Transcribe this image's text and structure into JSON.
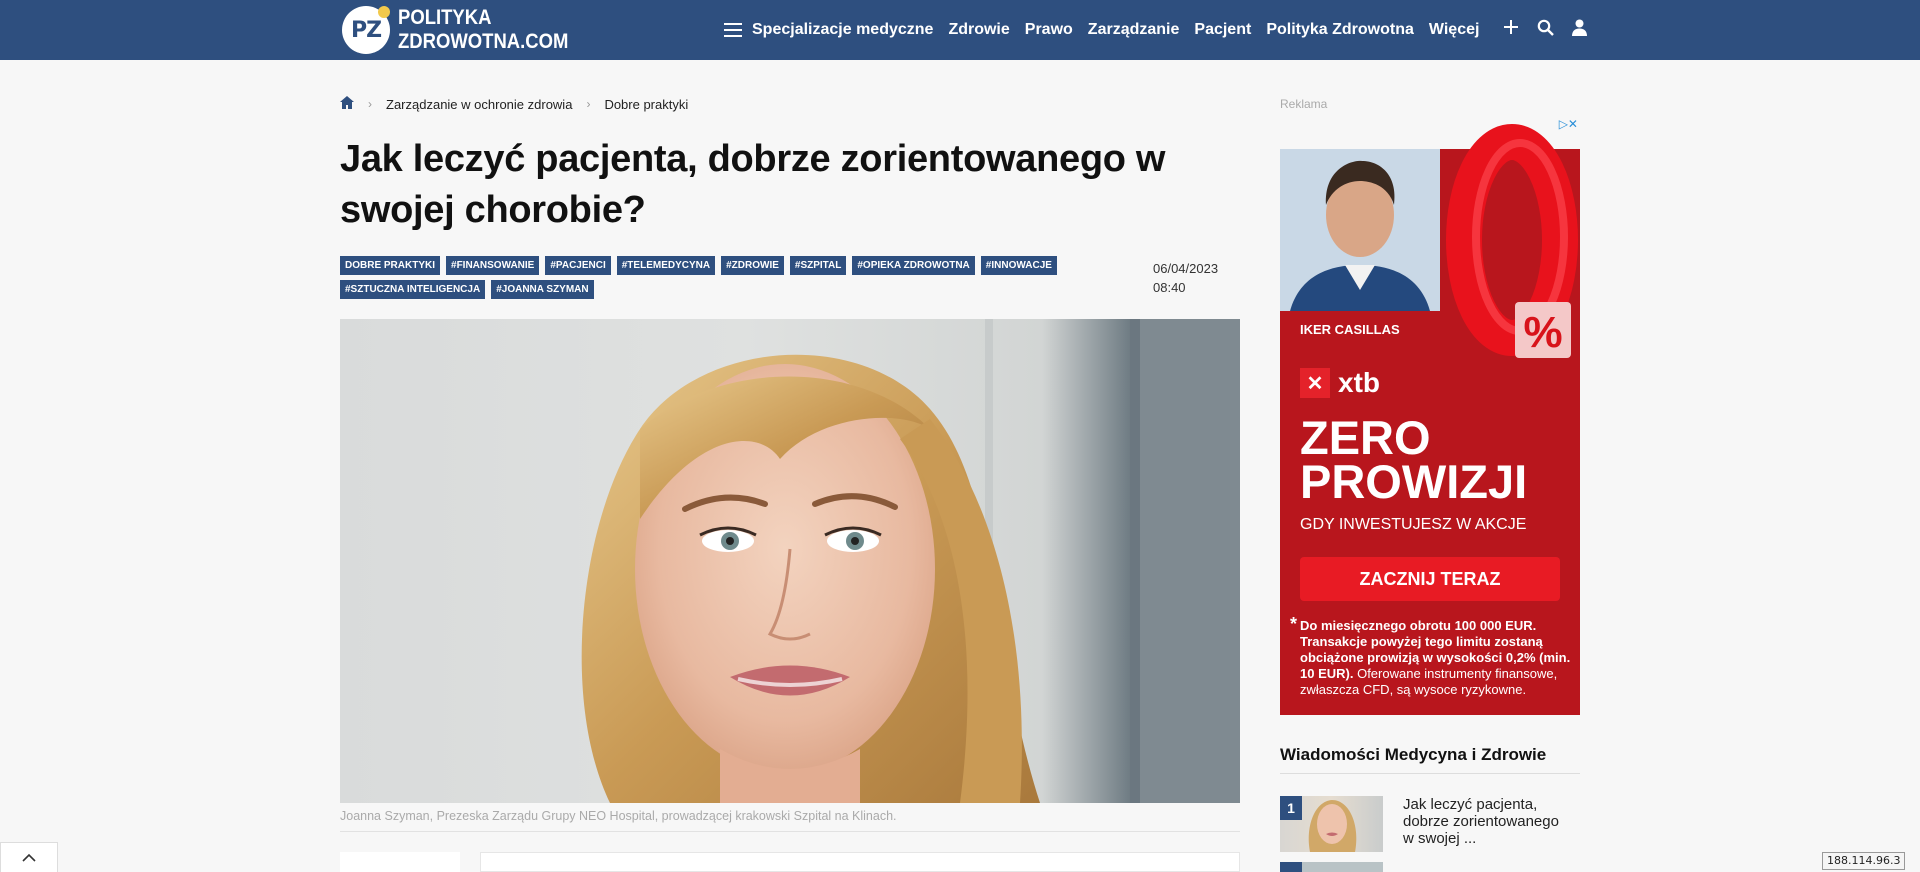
{
  "header": {
    "logo_badge": "PZ",
    "logo_line1": "POLITYKA",
    "logo_line2": "ZDROWOTNA.COM",
    "nav": [
      "Specjalizacje medyczne",
      "Zdrowie",
      "Prawo",
      "Zarządzanie",
      "Pacjent",
      "Polityka Zdrowotna",
      "Więcej"
    ],
    "icons": [
      "menu-icon",
      "plus-icon",
      "search-icon",
      "user-icon"
    ],
    "bg_color": "#2e4f7f"
  },
  "breadcrumb": {
    "items": [
      "Zarządzanie w ochronie zdrowia",
      "Dobre praktyki"
    ]
  },
  "article": {
    "title": "Jak leczyć pacjenta, dobrze zorientowanego w swojej chorobie?",
    "tags": [
      "DOBRE PRAKTYKI",
      "#FINANSOWANIE",
      "#PACJENCI",
      "#TELEMEDYCYNA",
      "#ZDROWIE",
      "#SZPITAL",
      "#OPIEKA ZDROWOTNA",
      "#INNOWACJE",
      "#SZTUCZNA INTELIGENCJA",
      "#JOANNA SZYMAN"
    ],
    "date": "06/04/2023",
    "time": "08:40",
    "caption": "Joanna Szyman, Prezeska Zarządu Grupy NEO Hospital, prowadzącej krakowski Szpital na Klinach."
  },
  "ad": {
    "label": "Reklama",
    "person": "IKER CASILLAS",
    "brand": "xtb",
    "headline_1": "ZERO",
    "headline_2": "PROWIZJI",
    "sub": "GDY INWESTUJESZ W AKCJE",
    "cta": "ZACZNIJ TERAZ",
    "fine_bold": "Do miesięcznego obrotu 100 000 EUR. Transakcje powyżej tego limitu zostaną obciążone prowizją w wysokości 0,2% (min. 10 EUR).",
    "fine_rest": " Oferowane instrumenty finansowe, zwłaszcza CFD, są wysoce ryzykowne.",
    "big_number": "0",
    "percent": "%",
    "bg_color": "#b8161d"
  },
  "sidebar": {
    "title": "Wiadomości Medycyna i Zdrowie",
    "items": [
      {
        "num": "1",
        "text": "Jak leczyć pacjenta, dobrze zorientowanego w swojej ..."
      }
    ]
  },
  "footer": {
    "ip": "188.114.96.3"
  }
}
